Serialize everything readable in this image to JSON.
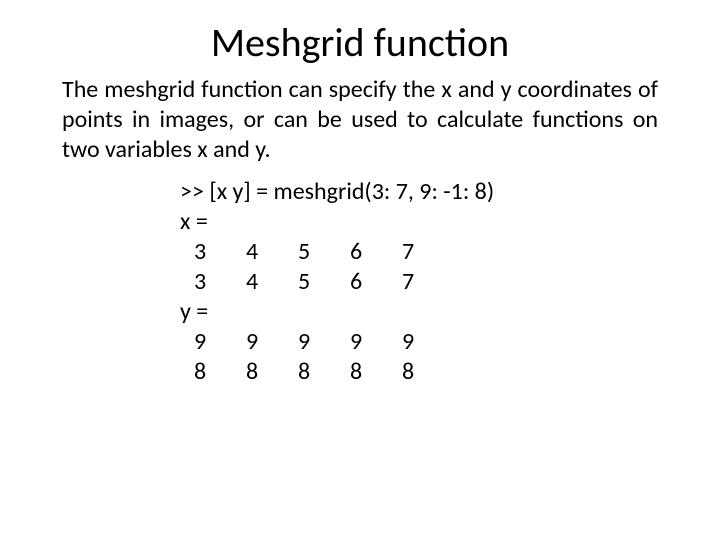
{
  "title": "Meshgrid function",
  "description": "The  meshgrid  function   can  specify  the  x  and   y  coordinates  of  points in images,  or can be used  to  calculate  functions  on  two variables  x and  y.",
  "code": {
    "command": ">> [x y] = meshgrid(3: 7, 9: -1: 8)",
    "x_label": "x =",
    "x_rows": [
      [
        "3",
        "4",
        "5",
        "6",
        "7"
      ],
      [
        "3",
        "4",
        "5",
        "6",
        "7"
      ]
    ],
    "y_label": "y =",
    "y_rows": [
      [
        "9",
        "9",
        "9",
        "9",
        "9"
      ],
      [
        "8",
        "8",
        "8",
        "8",
        "8"
      ]
    ]
  }
}
